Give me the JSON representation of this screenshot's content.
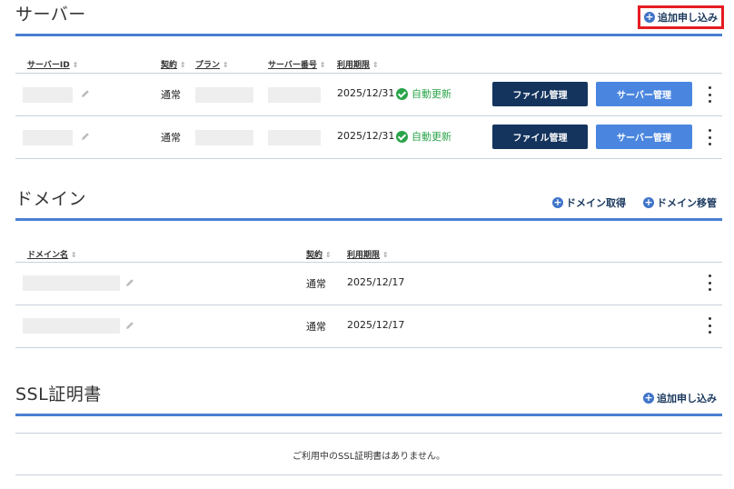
{
  "server": {
    "title": "サーバー",
    "add_link": "追加申し込み",
    "columns": {
      "server_id": "サーバーID",
      "contract": "契約",
      "plan": "プラン",
      "server_no": "サーバー番号",
      "expiry": "利用期限"
    },
    "rows": [
      {
        "contract": "通常",
        "expiry": "2025/12/31",
        "status": "自動更新",
        "file_btn": "ファイル管理",
        "server_btn": "サーバー管理"
      },
      {
        "contract": "通常",
        "expiry": "2025/12/31",
        "status": "自動更新",
        "file_btn": "ファイル管理",
        "server_btn": "サーバー管理"
      }
    ]
  },
  "domain": {
    "title": "ドメイン",
    "acquire_link": "ドメイン取得",
    "transfer_link": "ドメイン移管",
    "columns": {
      "domain_name": "ドメイン名",
      "contract": "契約",
      "expiry": "利用期限"
    },
    "rows": [
      {
        "contract": "通常",
        "expiry": "2025/12/17"
      },
      {
        "contract": "通常",
        "expiry": "2025/12/17"
      }
    ]
  },
  "ssl": {
    "title": "SSL証明書",
    "add_link": "追加申し込み",
    "empty_message": "ご利用中のSSL証明書はありません。"
  },
  "colors": {
    "accent": "#4a7fd1",
    "dark_button": "#14345e",
    "blue_button": "#4a86e0",
    "status_green": "#2aa44a",
    "highlight_red": "#e51c23"
  },
  "icons": {
    "add": "plus-circle-icon",
    "edit": "pencil-icon",
    "status": "check-circle-icon",
    "menu": "kebab-icon",
    "sort": "sort-icon"
  }
}
